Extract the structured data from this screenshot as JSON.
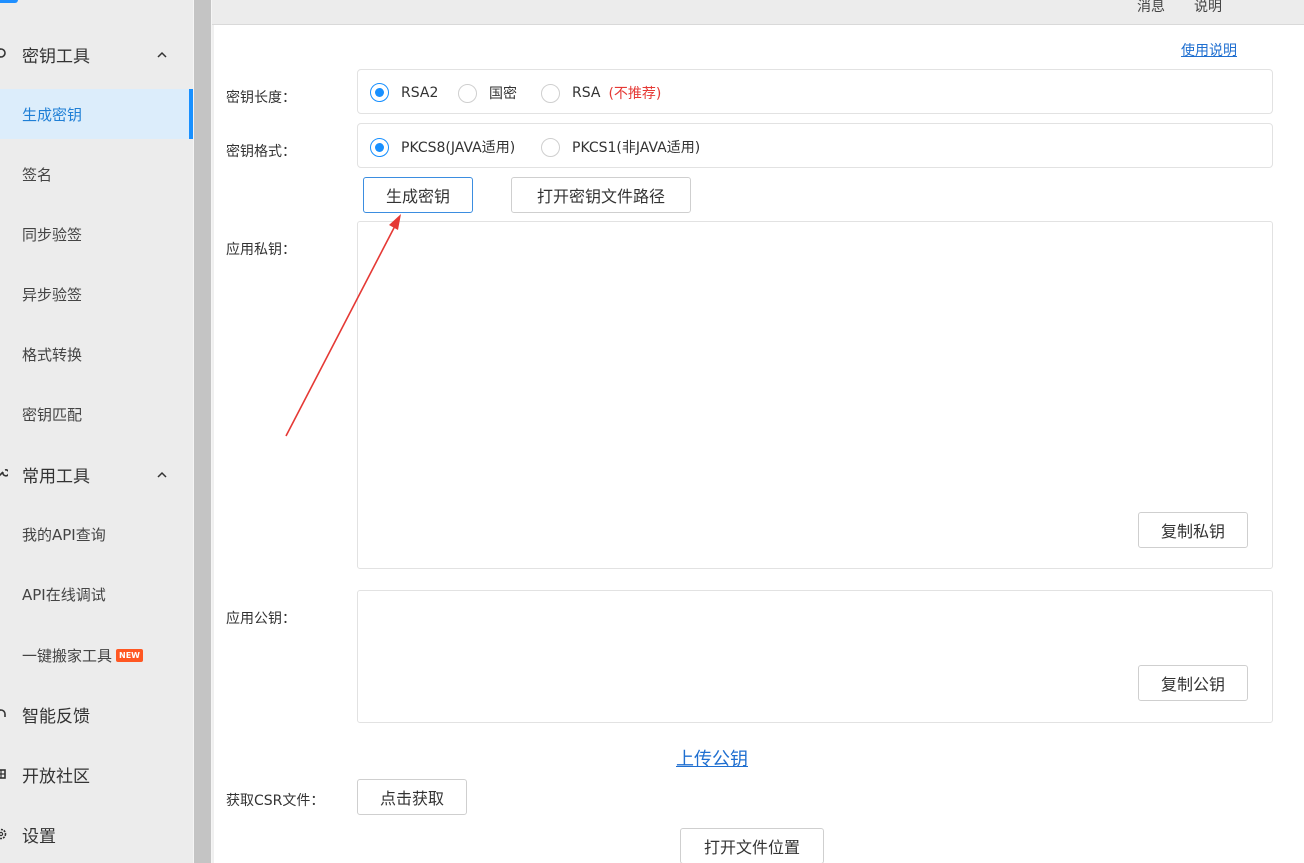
{
  "sidebar": {
    "groups": [
      {
        "label": "密钥工具",
        "icon": "key-icon"
      },
      {
        "label": "常用工具",
        "icon": "wrench-icon"
      },
      {
        "label": "智能反馈",
        "icon": "headset-icon"
      },
      {
        "label": "开放社区",
        "icon": "community-icon"
      },
      {
        "label": "设置",
        "icon": "gear-icon"
      }
    ],
    "items": [
      {
        "label": "生成密钥"
      },
      {
        "label": "签名"
      },
      {
        "label": "同步验签"
      },
      {
        "label": "异步验签"
      },
      {
        "label": "格式转换"
      },
      {
        "label": "密钥匹配"
      },
      {
        "label": "我的API查询"
      },
      {
        "label": "API在线调试"
      },
      {
        "label": "一键搬家工具",
        "badge": "NEW"
      }
    ]
  },
  "topbar": {
    "messages": "消息",
    "instructions": "说明"
  },
  "main": {
    "help_link": "使用说明",
    "key_length": {
      "label": "密钥长度：",
      "options": [
        "RSA2",
        "国密",
        "RSA"
      ],
      "selected": "RSA2",
      "rsa_warning": "(不推荐)"
    },
    "key_format": {
      "label": "密钥格式：",
      "options": [
        "PKCS8(JAVA适用)",
        "PKCS1(非JAVA适用)"
      ],
      "selected": "PKCS8(JAVA适用)"
    },
    "generate_button": "生成密钥",
    "open_path_button": "打开密钥文件路径",
    "private_key": {
      "label": "应用私钥：",
      "value": "",
      "copy_button": "复制私钥"
    },
    "public_key": {
      "label": "应用公钥：",
      "value": "",
      "copy_button": "复制公钥"
    },
    "upload_link": "上传公钥",
    "csr": {
      "label": "获取CSR文件：",
      "button": "点击获取"
    },
    "open_location_button": "打开文件位置"
  },
  "colors": {
    "accent": "#1890ff",
    "link": "#1f6fd0",
    "warning": "#e53935",
    "annotation_arrow": "#e53935"
  }
}
